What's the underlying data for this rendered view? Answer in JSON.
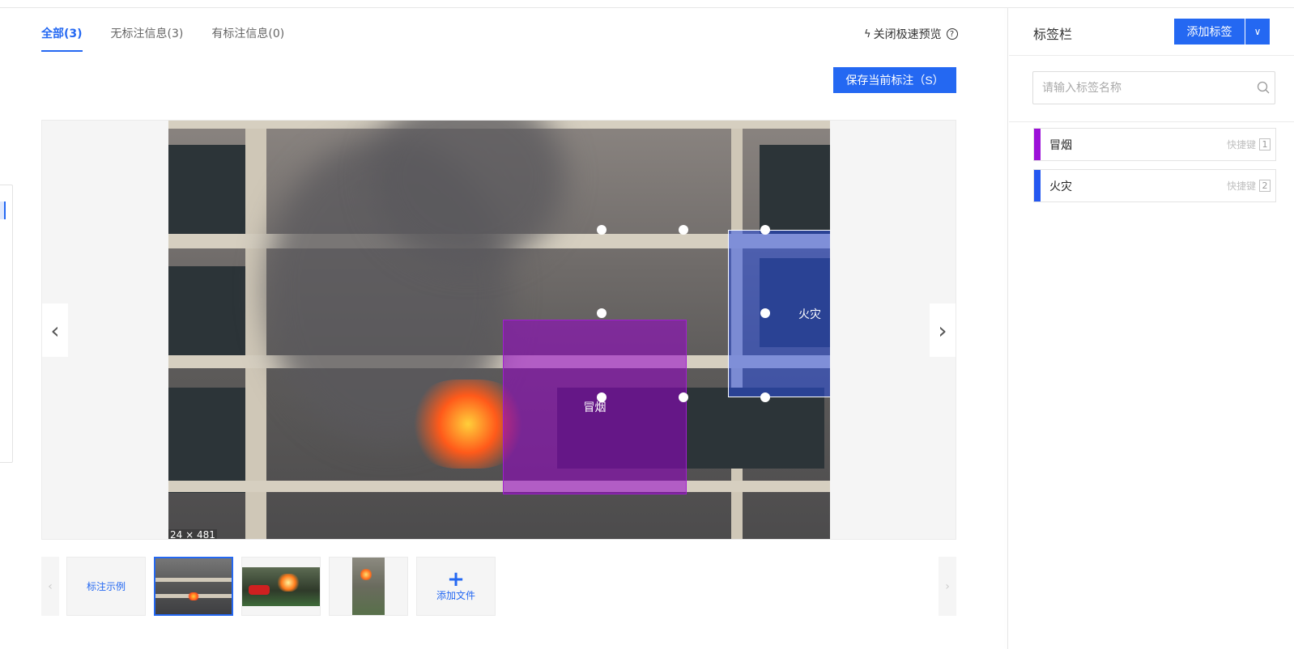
{
  "tabs": [
    {
      "label": "全部(3)",
      "active": true
    },
    {
      "label": "无标注信息(3)",
      "active": false
    },
    {
      "label": "有标注信息(0)",
      "active": false
    }
  ],
  "toolbar": {
    "fast_preview_label": "关闭极速预览",
    "save_label": "保存当前标注（S）"
  },
  "canvas": {
    "image_dims": "24 × 481",
    "annotations": [
      {
        "label": "冒烟",
        "color": "#a020d0"
      },
      {
        "label": "火灾",
        "color": "#2850f0"
      }
    ]
  },
  "thumbnails": {
    "example_label": "标注示例",
    "add_file_label": "添加文件",
    "add_icon": "plus-icon"
  },
  "panel": {
    "title": "标签栏",
    "add_tag_label": "添加标签",
    "search_placeholder": "请输入标签名称",
    "tags": [
      {
        "name": "冒烟",
        "hotkey_label": "快捷键",
        "hotkey": "1",
        "color": "#9b10d8"
      },
      {
        "name": "火灾",
        "hotkey_label": "快捷键",
        "hotkey": "2",
        "color": "#2457f0"
      }
    ]
  },
  "colors": {
    "accent": "#2468f2"
  }
}
